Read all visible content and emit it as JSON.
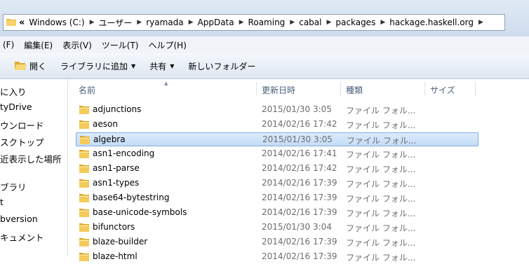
{
  "address": {
    "overflow": "«",
    "crumbs": [
      "Windows (C:)",
      "ユーザー",
      "ryamada",
      "AppData",
      "Roaming",
      "cabal",
      "packages",
      "hackage.haskell.org"
    ]
  },
  "menubar": [
    "(F)",
    "編集(E)",
    "表示(V)",
    "ツール(T)",
    "ヘルプ(H)"
  ],
  "toolbar": {
    "open": "開く",
    "add_to_library": "ライブラリに追加",
    "share": "共有",
    "new_folder": "新しいフォルダー"
  },
  "nav": [
    "に入り",
    "tyDrive",
    "ウンロード",
    "スクトップ",
    "近表示した場所",
    "ブラリ",
    "t",
    "bversion",
    "キュメント"
  ],
  "columns": {
    "name": "名前",
    "modified": "更新日時",
    "type": "種類",
    "size": "サイズ"
  },
  "files": [
    {
      "name": "adjunctions",
      "modified": "2015/01/30 3:05",
      "type": "ファイル フォル..."
    },
    {
      "name": "aeson",
      "modified": "2014/02/16 17:42",
      "type": "ファイル フォル..."
    },
    {
      "name": "algebra",
      "modified": "2015/01/30 3:05",
      "type": "ファイル フォル..."
    },
    {
      "name": "asn1-encoding",
      "modified": "2014/02/16 17:41",
      "type": "ファイル フォル..."
    },
    {
      "name": "asn1-parse",
      "modified": "2014/02/16 17:42",
      "type": "ファイル フォル..."
    },
    {
      "name": "asn1-types",
      "modified": "2014/02/16 17:39",
      "type": "ファイル フォル..."
    },
    {
      "name": "base64-bytestring",
      "modified": "2014/02/16 17:39",
      "type": "ファイル フォル..."
    },
    {
      "name": "base-unicode-symbols",
      "modified": "2014/02/16 17:39",
      "type": "ファイル フォル..."
    },
    {
      "name": "bifunctors",
      "modified": "2015/01/30 3:04",
      "type": "ファイル フォル..."
    },
    {
      "name": "blaze-builder",
      "modified": "2014/02/16 17:39",
      "type": "ファイル フォル..."
    },
    {
      "name": "blaze-html",
      "modified": "2014/02/16 17:39",
      "type": "ファイル フォル..."
    }
  ],
  "selected_index": 2
}
